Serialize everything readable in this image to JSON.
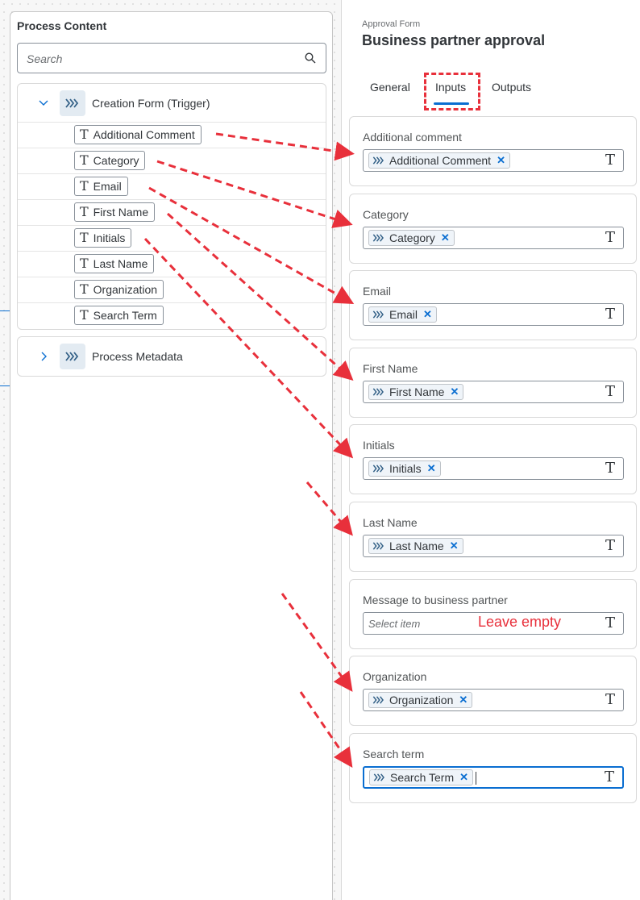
{
  "left_panel": {
    "title": "Process Content",
    "search": {
      "placeholder": "Search",
      "icon": "search-icon"
    },
    "trigger": {
      "label": "Creation Form (Trigger)",
      "icon": "process-flow-icon",
      "expanded": true,
      "items": [
        {
          "label": "Additional Comment",
          "icon": "text-type-icon"
        },
        {
          "label": "Category",
          "icon": "text-type-icon"
        },
        {
          "label": "Email",
          "icon": "text-type-icon"
        },
        {
          "label": "First Name",
          "icon": "text-type-icon"
        },
        {
          "label": "Initials",
          "icon": "text-type-icon"
        },
        {
          "label": "Last Name",
          "icon": "text-type-icon"
        },
        {
          "label": "Organization",
          "icon": "text-type-icon"
        },
        {
          "label": "Search Term",
          "icon": "text-type-icon"
        }
      ]
    },
    "metadata": {
      "label": "Process Metadata",
      "icon": "process-flow-icon",
      "expanded": false
    }
  },
  "right_panel": {
    "kicker": "Approval Form",
    "title": "Business partner approval",
    "tabs": [
      {
        "label": "General",
        "selected": false
      },
      {
        "label": "Inputs",
        "selected": true
      },
      {
        "label": "Outputs",
        "selected": false
      }
    ],
    "inputs": [
      {
        "label": "Additional comment",
        "token": "Additional Comment"
      },
      {
        "label": "Category",
        "token": "Category"
      },
      {
        "label": "Email",
        "token": "Email"
      },
      {
        "label": "First Name",
        "token": "First Name"
      },
      {
        "label": "Initials",
        "token": "Initials"
      },
      {
        "label": "Last Name",
        "token": "Last Name"
      },
      {
        "label": "Message to business partner",
        "token": null,
        "placeholder": "Select item",
        "note": "Leave empty"
      },
      {
        "label": "Organization",
        "token": "Organization"
      },
      {
        "label": "Search term",
        "token": "Search Term",
        "focused": true
      }
    ],
    "type_glyph": "T",
    "remove_glyph": "✕"
  },
  "colors": {
    "accent": "#0a6ed1",
    "annotation": "#e8303b",
    "icon_bg": "#e3ebf2"
  }
}
